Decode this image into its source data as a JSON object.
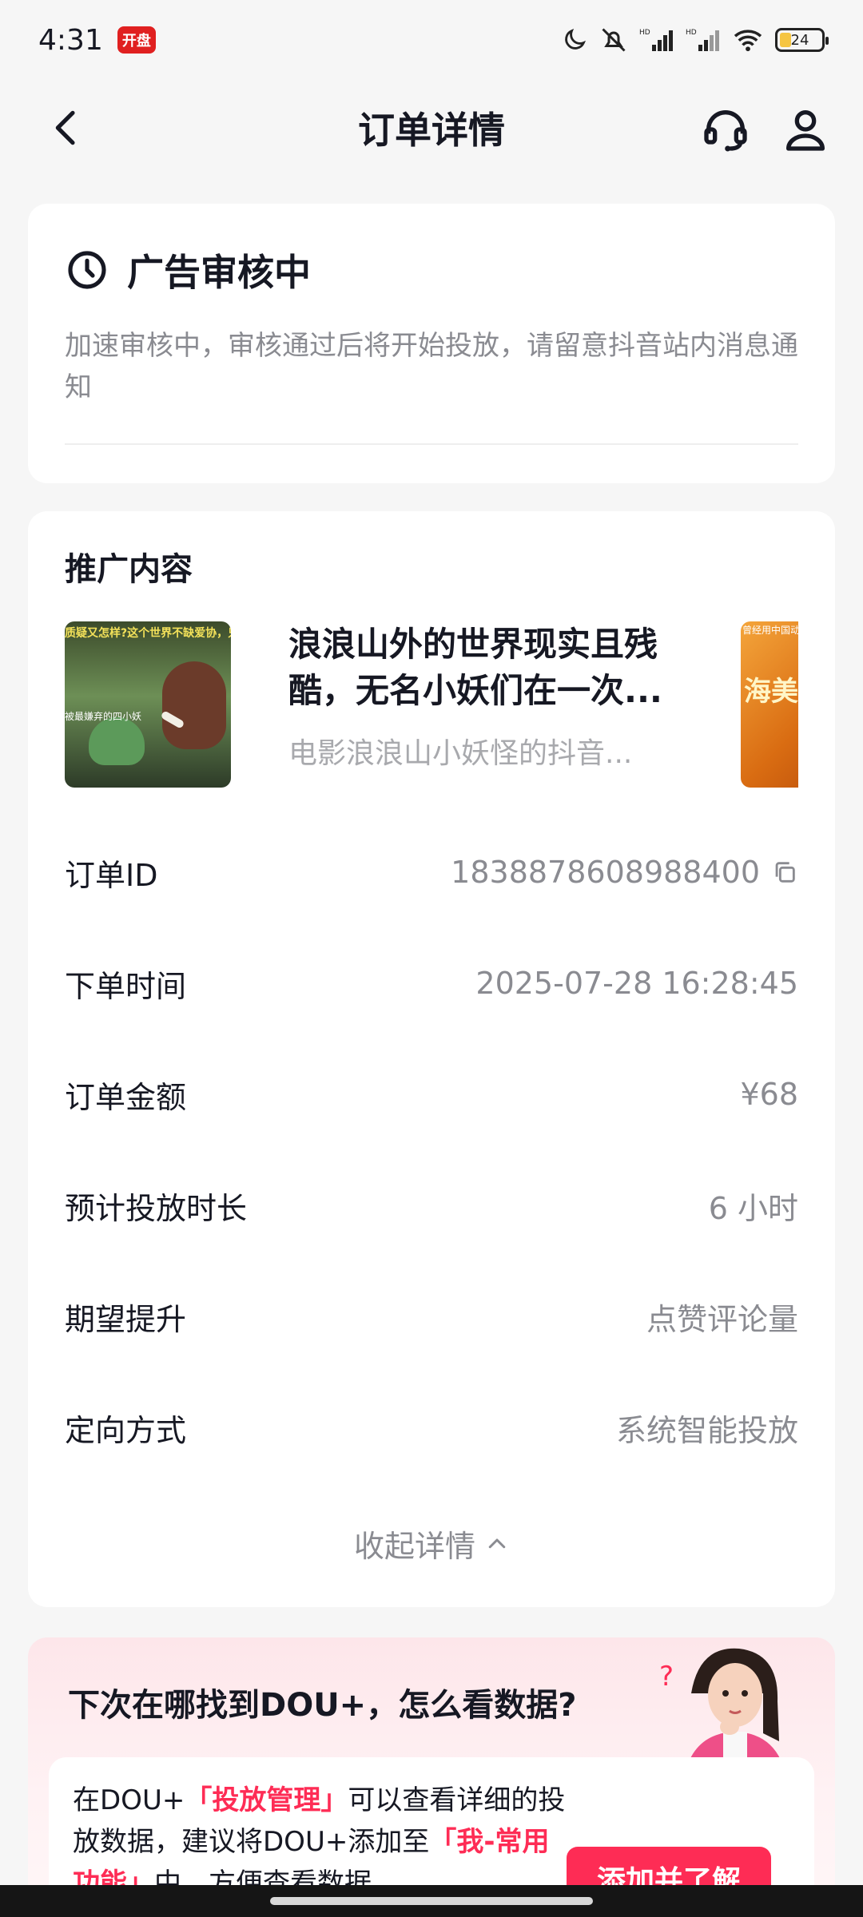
{
  "status_bar": {
    "time": "4:31",
    "badge": "开盘",
    "battery": "24",
    "hd1": "HD",
    "hd2": "HD"
  },
  "nav": {
    "title": "订单详情",
    "back_icon": "chevron-left-icon",
    "service_icon": "headset-icon",
    "user_icon": "user-icon"
  },
  "status_card": {
    "icon": "clock-icon",
    "title": "广告审核中",
    "description": "加速审核中，审核通过后将开始投放，请留意抖音站内消息通知"
  },
  "promotion": {
    "section_title": "推广内容",
    "item_title": "浪浪山外的世界现实且残酷，无名小妖们在一次...",
    "item_subtitle": "电影浪浪山小妖怪的抖音...",
    "thumb1_caption": "质疑又怎样?这个世界不缺爱协，只缺勇",
    "thumb1_label": "被最嫌弃的四小妖",
    "thumb2_caption": "曾经用中国动画惊艳了世",
    "thumb2_text": "海美术电"
  },
  "details": [
    {
      "label": "订单ID",
      "value": "1838878608988400"
    },
    {
      "label": "下单时间",
      "value": "2025-07-28 16:28:45"
    },
    {
      "label": "订单金额",
      "value": "¥68"
    },
    {
      "label": "预计投放时长",
      "value": "6 小时"
    },
    {
      "label": "期望提升",
      "value": "点赞评论量"
    },
    {
      "label": "定向方式",
      "value": "系统智能投放"
    }
  ],
  "collapse_label": "收起详情",
  "tip": {
    "title": "下次在哪找到DOU+，怎么看数据?",
    "text_1": "在DOU+",
    "highlight_1": "「投放管理」",
    "text_2": "可以查看详细的投放数据，建议将DOU+添加至",
    "highlight_2": "「我-常用功能」",
    "text_3": "中，方便查看数据",
    "button": "添加并了解"
  },
  "colors": {
    "accent": "#fe2c55",
    "muted": "#8a8b91",
    "background": "#f6f6f6"
  }
}
